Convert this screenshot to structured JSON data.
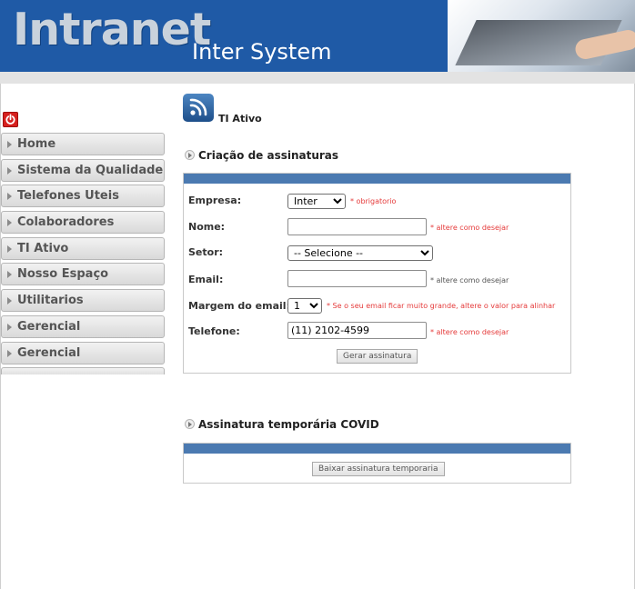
{
  "header": {
    "brand": "Intranet",
    "subtitle": "Inter System"
  },
  "sidebar": {
    "items": [
      {
        "label": "Home"
      },
      {
        "label": "Sistema da Qualidade"
      },
      {
        "label": "Telefones Uteis"
      },
      {
        "label": "Colaboradores"
      },
      {
        "label": "TI Ativo"
      },
      {
        "label": "Nosso Espaço"
      },
      {
        "label": "Utilitarios"
      },
      {
        "label": "Gerencial"
      },
      {
        "label": "Gerencial"
      }
    ]
  },
  "page": {
    "title": "TI Ativo"
  },
  "form_section": {
    "title": "Criação de assinaturas",
    "fields": {
      "empresa": {
        "label": "Empresa:",
        "value": "Inter",
        "note": "* obrigatorio"
      },
      "nome": {
        "label": "Nome:",
        "value": "",
        "note": "* altere como desejar"
      },
      "setor": {
        "label": "Setor:",
        "value": "-- Selecione --"
      },
      "email": {
        "label": "Email:",
        "value": "",
        "note": "* altere como desejar"
      },
      "margem": {
        "label": "Margem do email:",
        "value": "1",
        "note": "* Se o seu email ficar muito grande, altere o valor para alinhar"
      },
      "telefone": {
        "label": "Telefone:",
        "value": "(11) 2102-4599",
        "note": "* altere como desejar"
      }
    },
    "submit_label": "Gerar assinatura"
  },
  "covid_section": {
    "title": "Assinatura temporária COVID",
    "download_label": "Baixar assinatura temporaria"
  },
  "colors": {
    "header_blue": "#1f5aa6",
    "panel_bar": "#4b7ab1",
    "note_red": "#e53b3b",
    "power_red": "#d6201e"
  },
  "icons": [
    "power-icon",
    "rss-icon",
    "arrow-right-icon",
    "bullet-arrow-icon"
  ]
}
